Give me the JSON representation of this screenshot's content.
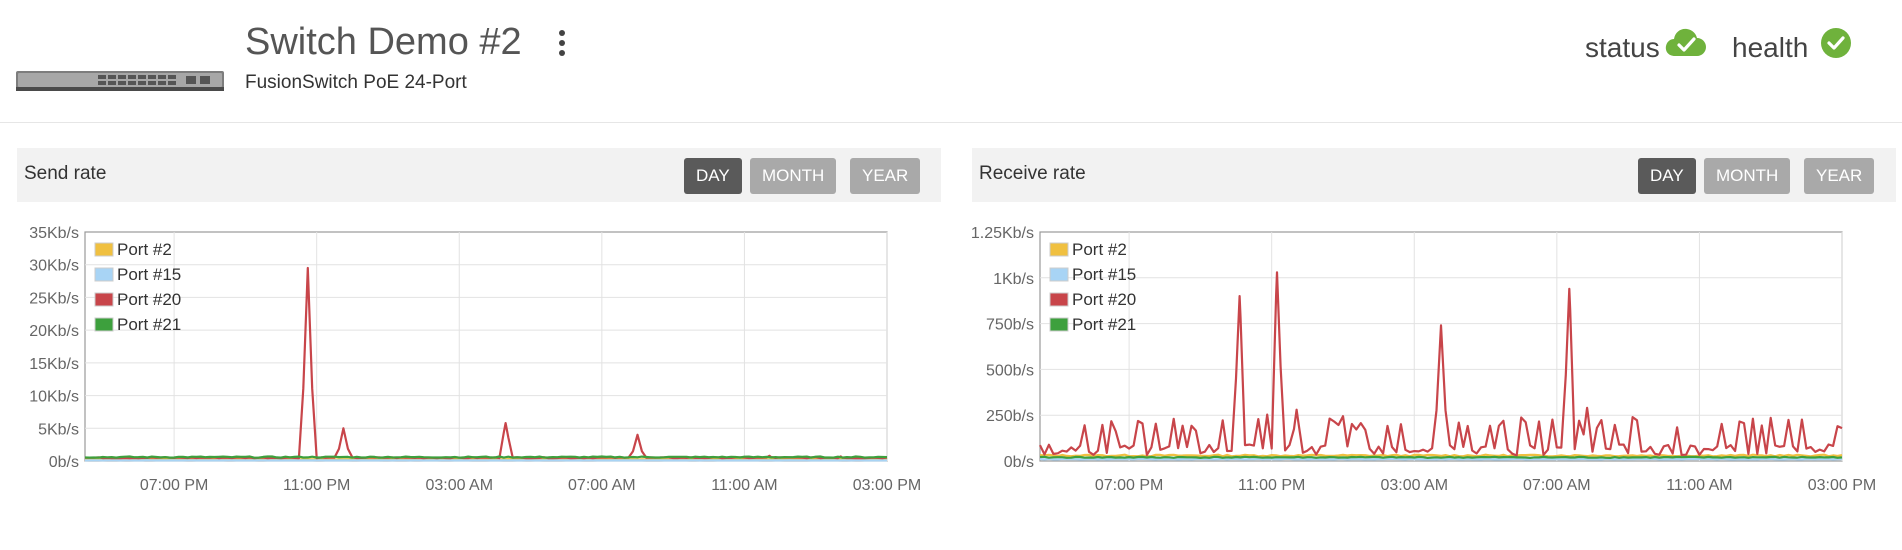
{
  "header": {
    "title": "Switch Demo #2",
    "subtitle": "FusionSwitch PoE 24-Port",
    "status_label": "status",
    "health_label": "health",
    "status_icon": "cloud-check-icon",
    "health_icon": "check-circle-icon",
    "menu_icon": "kebab-menu-icon",
    "colors": {
      "ok_green": "#6fb23c"
    }
  },
  "range_buttons": [
    "DAY",
    "MONTH",
    "YEAR"
  ],
  "charts": [
    {
      "title": "Send rate",
      "active_range": "DAY"
    },
    {
      "title": "Receive rate",
      "active_range": "DAY"
    }
  ],
  "chart_data": [
    {
      "type": "line",
      "title": "Send rate",
      "x_ticks": [
        "07:00 PM",
        "11:00 PM",
        "03:00 AM",
        "07:00 AM",
        "11:00 AM",
        "03:00 PM"
      ],
      "y_ticks": [
        "0b/s",
        "5Kb/s",
        "10Kb/s",
        "15Kb/s",
        "20Kb/s",
        "25Kb/s",
        "30Kb/s",
        "35Kb/s"
      ],
      "ylim": [
        0,
        35
      ],
      "y_unit": "Kb/s",
      "x_range_hours": [
        16.5,
        39.0
      ],
      "legend": {
        "position": "top-left"
      },
      "grid": true,
      "series": [
        {
          "name": "Port #2",
          "color": "#f0c040",
          "baseline": 0.25,
          "spikes": []
        },
        {
          "name": "Port #15",
          "color": "#a8d4f5",
          "baseline": 0.1,
          "spikes": []
        },
        {
          "name": "Port #20",
          "color": "#c8454a",
          "baseline": 0.5,
          "spikes": [
            [
              22.75,
              29.5
            ],
            [
              23.75,
              5.0
            ],
            [
              28.3,
              5.8
            ],
            [
              32.0,
              4.0
            ],
            [
              35.7,
              0.8
            ],
            [
              37.7,
              0.7
            ]
          ]
        },
        {
          "name": "Port #21",
          "color": "#3da03d",
          "baseline": 0.6,
          "spikes": []
        }
      ]
    },
    {
      "type": "line",
      "title": "Receive rate",
      "x_ticks": [
        "07:00 PM",
        "11:00 PM",
        "03:00 AM",
        "07:00 AM",
        "11:00 AM",
        "03:00 PM"
      ],
      "y_ticks": [
        "0b/s",
        "250b/s",
        "500b/s",
        "750b/s",
        "1Kb/s",
        "1.25Kb/s"
      ],
      "ylim": [
        0,
        1.25
      ],
      "y_unit": "Kb/s",
      "x_range_hours": [
        16.5,
        39.0
      ],
      "legend": {
        "position": "top-left"
      },
      "grid": true,
      "series": [
        {
          "name": "Port #2",
          "color": "#f0c040",
          "baseline": 0.03,
          "spikes": []
        },
        {
          "name": "Port #15",
          "color": "#a8d4f5",
          "baseline": 0.01,
          "spikes": []
        },
        {
          "name": "Port #20",
          "color": "#c8454a",
          "baseline": 0.06,
          "spikes": [
            [
              22.1,
              0.9
            ],
            [
              23.15,
              1.03
            ],
            [
              23.7,
              0.28
            ],
            [
              27.75,
              0.74
            ],
            [
              31.35,
              0.94
            ],
            [
              31.85,
              0.29
            ]
          ],
          "noise_peak": 0.19
        },
        {
          "name": "Port #21",
          "color": "#3da03d",
          "baseline": 0.02,
          "spikes": []
        }
      ]
    }
  ]
}
